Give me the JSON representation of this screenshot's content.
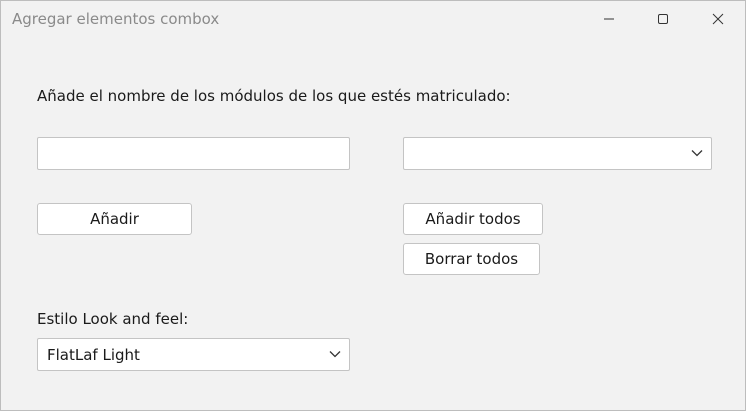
{
  "window": {
    "title": "Agregar elementos combox"
  },
  "title_controls": {
    "minimize_icon": "minimize-icon",
    "maximize_icon": "maximize-icon",
    "close_icon": "close-icon"
  },
  "form": {
    "instruction": "Añade el nombre de los módulos de los que estés matriculado:",
    "module_input": {
      "value": "",
      "placeholder": ""
    },
    "modules_combo": {
      "selected": ""
    },
    "add_label": "Añadir",
    "add_all_label": "Añadir todos",
    "delete_all_label": "Borrar todos",
    "laf_label": "Estilo Look and feel:",
    "laf_combo": {
      "selected": "FlatLaf Light"
    }
  },
  "colors": {
    "window_bg": "#f2f2f2",
    "field_bg": "#ffffff",
    "border": "#c4c4c4",
    "title_text": "#8a8a8a"
  }
}
